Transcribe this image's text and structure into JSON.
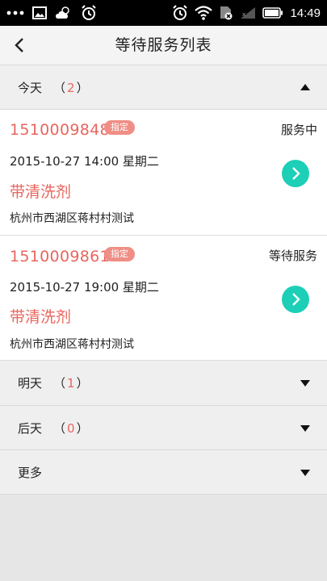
{
  "status_bar": {
    "time": "14:49"
  },
  "nav": {
    "title": "等待服务列表"
  },
  "sections": [
    {
      "label": "今天",
      "open": "（",
      "count": "2",
      "close": "）",
      "expanded": true
    },
    {
      "label": "明天",
      "open": "（",
      "count": "1",
      "close": "）",
      "expanded": false
    },
    {
      "label": "后天",
      "open": "（",
      "count": "0",
      "close": "）",
      "expanded": false
    },
    {
      "label": "更多",
      "expanded": false
    }
  ],
  "orders": [
    {
      "number": "1510009848",
      "tag": "指定",
      "status": "服务中",
      "datetime": "2015-10-27 14:00 星期二",
      "service": "带清洗剂",
      "address": "杭州市西湖区蒋村村测试"
    },
    {
      "number": "1510009861",
      "tag": "指定",
      "status": "等待服务",
      "datetime": "2015-10-27 19:00 星期二",
      "service": "带清洗剂",
      "address": "杭州市西湖区蒋村村测试"
    }
  ],
  "colors": {
    "accent_red": "#e8665e",
    "tag_bg": "#ef8e86",
    "go_button": "#1dcfb7",
    "status_bar": "#000000"
  },
  "icons": [
    "more-dots-icon",
    "image-icon",
    "weather-cloud-icon",
    "alarm-icon",
    "wifi-icon",
    "signal-icon",
    "battery-icon",
    "back-arrow-icon",
    "caret-up-icon",
    "caret-down-icon",
    "chevron-right-icon"
  ]
}
